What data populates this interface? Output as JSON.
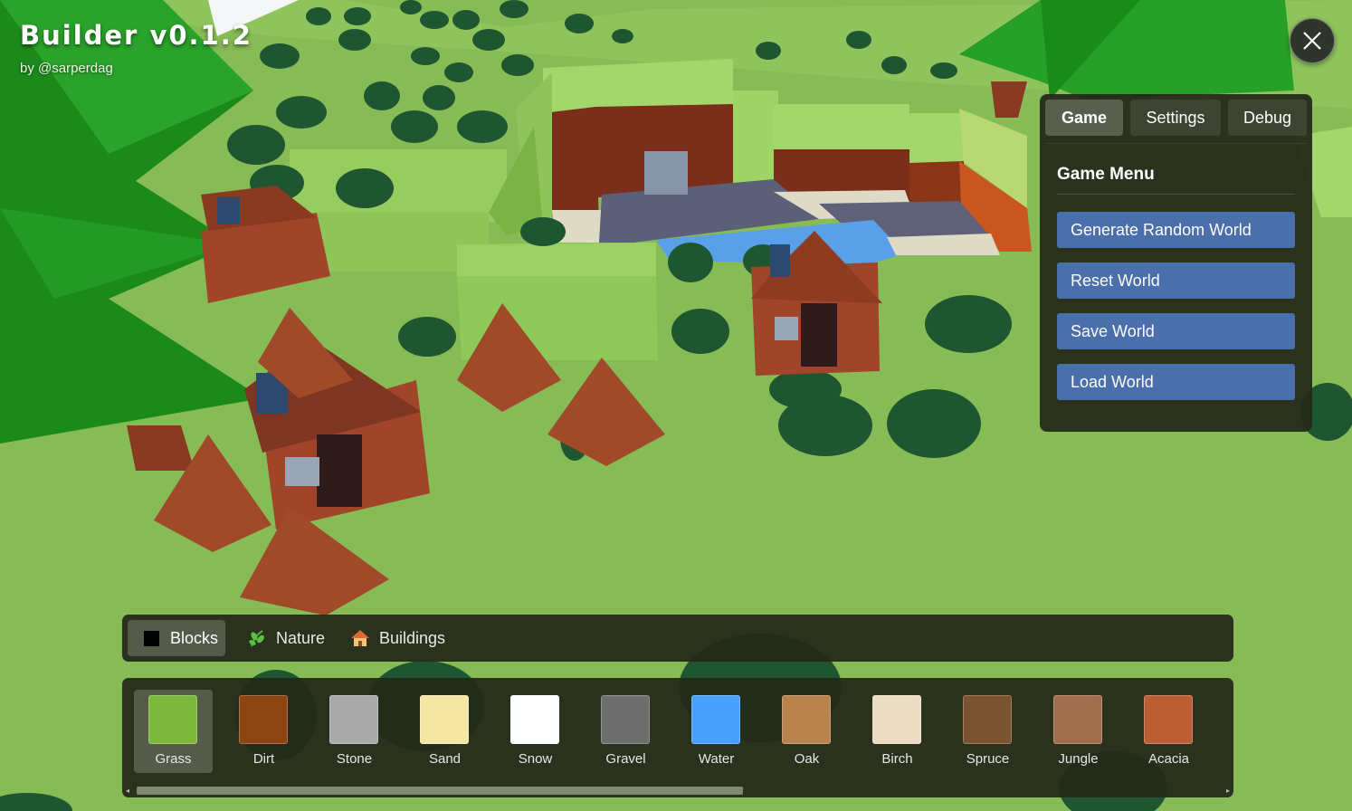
{
  "header": {
    "title": "Builder v0.1.2",
    "subtitle": "by @sarperdag"
  },
  "close_button": {
    "icon": "close-icon"
  },
  "menu_panel": {
    "tabs": [
      {
        "label": "Game",
        "active": true
      },
      {
        "label": "Settings",
        "active": false
      },
      {
        "label": "Debug",
        "active": false
      }
    ],
    "heading": "Game Menu",
    "buttons": [
      "Generate Random World",
      "Reset World",
      "Save World",
      "Load World"
    ],
    "button_color": "#4a6faa"
  },
  "categories": [
    {
      "label": "Blocks",
      "icon": "black-square-icon",
      "active": true
    },
    {
      "label": "Nature",
      "icon": "herb-icon",
      "active": false
    },
    {
      "label": "Buildings",
      "icon": "house-icon",
      "active": false
    }
  ],
  "blocks": [
    {
      "label": "Grass",
      "color": "#7cb83c",
      "selected": true
    },
    {
      "label": "Dirt",
      "color": "#8b4513",
      "selected": false
    },
    {
      "label": "Stone",
      "color": "#a9a9a9",
      "selected": false
    },
    {
      "label": "Sand",
      "color": "#f6e6a6",
      "selected": false
    },
    {
      "label": "Snow",
      "color": "#ffffff",
      "selected": false
    },
    {
      "label": "Gravel",
      "color": "#6e6e6e",
      "selected": false
    },
    {
      "label": "Water",
      "color": "#4aa0ff",
      "selected": false
    },
    {
      "label": "Oak",
      "color": "#b8834c",
      "selected": false
    },
    {
      "label": "Birch",
      "color": "#ebdcc4",
      "selected": false
    },
    {
      "label": "Spruce",
      "color": "#7a5430",
      "selected": false
    },
    {
      "label": "Jungle",
      "color": "#a06e4c",
      "selected": false
    },
    {
      "label": "Acacia",
      "color": "#bc5e34",
      "selected": false
    }
  ],
  "palette_scroll": {
    "visible_fraction": 0.56
  }
}
